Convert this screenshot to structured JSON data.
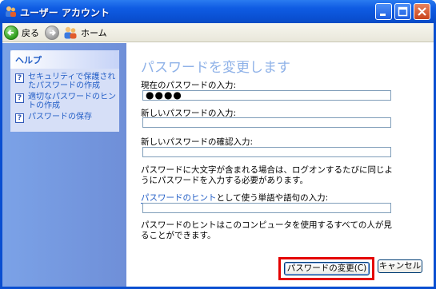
{
  "window": {
    "title": "ユーザー アカウント",
    "colors": {
      "title_bar": "#0a4fd1",
      "sidebar": "#7ba2e7",
      "highlight": "#e40000",
      "link": "#215dc6"
    }
  },
  "toolbar": {
    "back_label": "戻る",
    "home_label": "ホーム"
  },
  "sidebar": {
    "help_title": "ヘルプ",
    "items": [
      {
        "label": "セキュリティで保護されたパスワードの作成"
      },
      {
        "label": "適切なパスワードのヒントの作成"
      },
      {
        "label": "パスワードの保存"
      }
    ]
  },
  "main": {
    "title": "パスワードを変更します",
    "current_label": "現在のパスワードの入力:",
    "current_value": "●●●●",
    "new_label": "新しいパスワードの入力:",
    "new_value": "",
    "confirm_label": "新しいパスワードの確認入力:",
    "confirm_value": "",
    "case_note": "パスワードに大文字が含まれる場合は、ログオンするたびに同じようにパスワードを入力する必要があります。",
    "hint_link": "パスワードのヒント",
    "hint_label_rest": "として使う単語や語句の入力:",
    "hint_value": "",
    "hint_note": "パスワードのヒントはこのコンピュータを使用するすべての人が見ることができます。"
  },
  "buttons": {
    "change": "パスワードの変更(C)",
    "cancel": "キャンセル"
  }
}
